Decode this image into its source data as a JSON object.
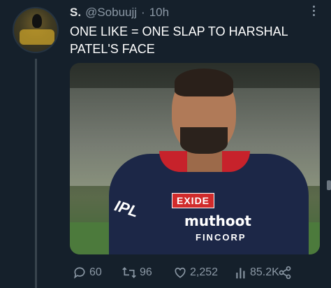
{
  "tweet": {
    "author_name": "S.",
    "handle": "@Sobuujj",
    "separator": "·",
    "time": "10h",
    "text": "ONE LIKE = ONE SLAP TO HARSHAL PATEL'S FACE"
  },
  "media": {
    "sponsor_1": "EXIDE",
    "sponsor_2": "muthoot",
    "sponsor_3": "FINCORP",
    "league": "IPL"
  },
  "actions": {
    "replies": "60",
    "retweets": "96",
    "likes": "2,252",
    "views": "85.2K"
  },
  "icons": {
    "reply": "reply-icon",
    "retweet": "retweet-icon",
    "like": "heart-icon",
    "views": "views-icon",
    "share": "share-icon",
    "more": "more-icon"
  },
  "colors": {
    "background": "#15202b",
    "secondary_text": "#8b98a5",
    "primary_text": "#e7e9ea"
  }
}
